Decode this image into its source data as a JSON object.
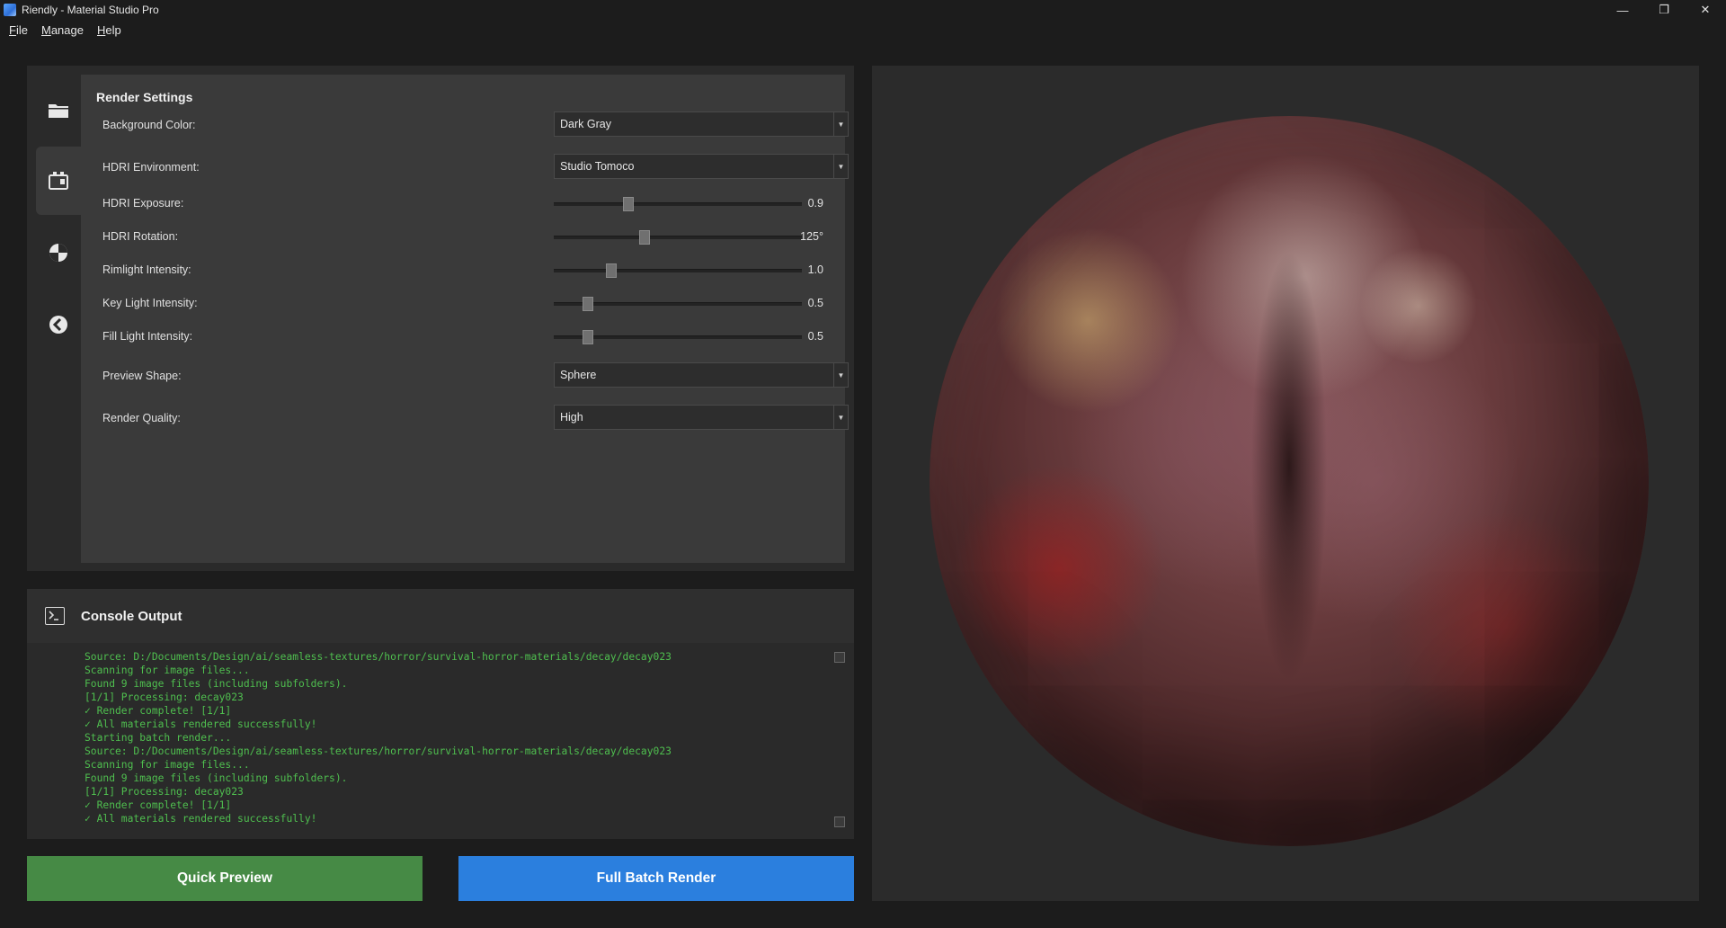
{
  "window": {
    "title": "Riendly - Material Studio Pro",
    "controls": [
      "—",
      "❐",
      "✕"
    ]
  },
  "menu": {
    "items": [
      {
        "label": "File",
        "accel": "F",
        "rest": "ile"
      },
      {
        "label": "Manage",
        "accel": "M",
        "rest": "anage"
      },
      {
        "label": "Help",
        "accel": "H",
        "rest": "elp"
      }
    ]
  },
  "sidebar": {
    "items": [
      {
        "icon": "folder-icon"
      },
      {
        "icon": "render-settings-icon"
      },
      {
        "icon": "material-icon"
      },
      {
        "icon": "history-icon"
      }
    ]
  },
  "render_settings": {
    "title": "Render Settings",
    "background_color": {
      "label": "Background Color:",
      "value": "Dark Gray"
    },
    "hdri_environment": {
      "label": "HDRI Environment:",
      "value": "Studio Tomoco"
    },
    "hdri_exposure": {
      "label": "HDRI Exposure:",
      "display": "0.9",
      "fraction": 0.29
    },
    "hdri_rotation": {
      "label": "HDRI Rotation:",
      "display": "125°",
      "fraction": 0.36
    },
    "rimlight_intensity": {
      "label": "Rimlight Intensity:",
      "display": "1.0",
      "fraction": 0.22
    },
    "key_light_intensity": {
      "label": "Key Light Intensity:",
      "display": "0.5",
      "fraction": 0.12
    },
    "fill_light_intensity": {
      "label": "Fill Light Intensity:",
      "display": "0.5",
      "fraction": 0.12
    },
    "preview_shape": {
      "label": "Preview Shape:",
      "value": "Sphere"
    },
    "render_quality": {
      "label": "Render Quality:",
      "value": "High"
    }
  },
  "console": {
    "title": "Console Output",
    "lines": [
      "Source: D:/Documents/Design/ai/seamless-textures/horror/survival-horror-materials/decay/decay023",
      "Scanning for image files...",
      "Found 9 image files (including subfolders).",
      "[1/1] Processing: decay023",
      "✓ Render complete! [1/1]",
      "✓ All materials rendered successfully!",
      "Starting batch render...",
      "Source: D:/Documents/Design/ai/seamless-textures/horror/survival-horror-materials/decay/decay023",
      "Scanning for image files...",
      "Found 9 image files (including subfolders).",
      "[1/1] Processing: decay023",
      "✓ Render complete! [1/1]",
      "✓ All materials rendered successfully!"
    ]
  },
  "actions": {
    "quick_preview": "Quick Preview",
    "full_batch_render": "Full Batch Render"
  },
  "colors": {
    "quick_preview_bg": "#468a45",
    "batch_render_bg": "#2b7fde",
    "console_text": "#4fbf4f"
  }
}
